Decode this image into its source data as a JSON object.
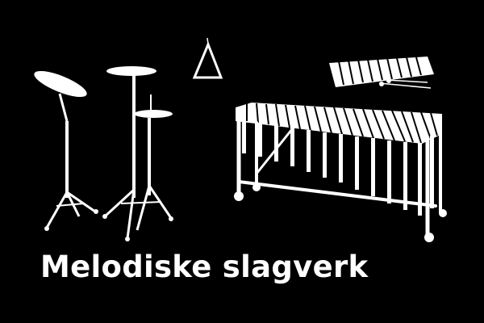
{
  "title": "Melodiske slagverk",
  "colors": {
    "background": "#000000",
    "foreground": "#ffffff"
  },
  "icons": [
    "cymbal-icon",
    "hi-hat-icon",
    "triangle-icon",
    "glockenspiel-icon",
    "marimba-icon"
  ]
}
